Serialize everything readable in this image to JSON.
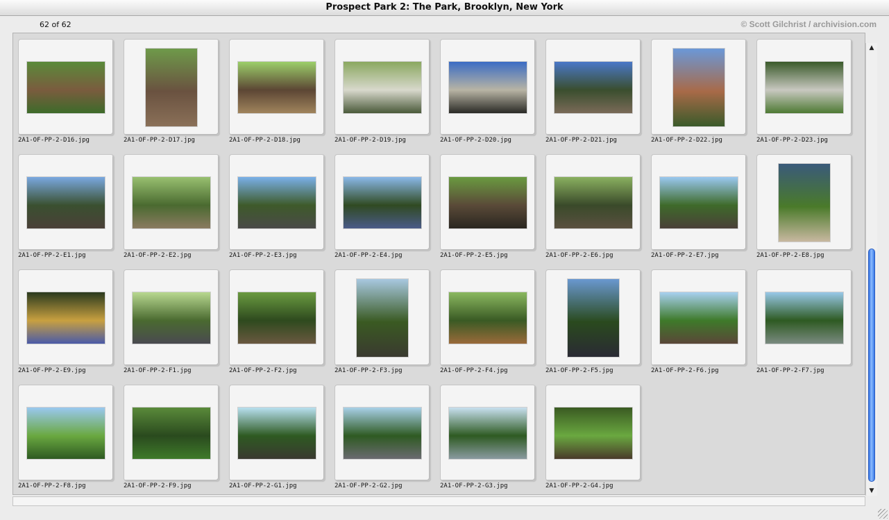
{
  "window": {
    "title": "Prospect Park 2: The Park, Brooklyn, New York"
  },
  "status": {
    "count": "62 of 62",
    "credit": "© Scott Gilchrist / archivision.com"
  },
  "icons": {
    "scroll_up": "scroll-up-arrow-icon",
    "scroll_down": "scroll-down-arrow-icon",
    "resize": "resize-grip-icon"
  },
  "thumbnails": [
    {
      "file": "2A1-OF-PP-2-D16.jpg",
      "orientation": "landscape",
      "colors": [
        "#5a8a3a",
        "#7a5c3e",
        "#3d6b2a"
      ]
    },
    {
      "file": "2A1-OF-PP-2-D17.jpg",
      "orientation": "portrait",
      "colors": [
        "#6e9a4a",
        "#6a5240",
        "#8a7058"
      ]
    },
    {
      "file": "2A1-OF-PP-2-D18.jpg",
      "orientation": "landscape",
      "colors": [
        "#9ccf6a",
        "#5c4634",
        "#a0845c"
      ]
    },
    {
      "file": "2A1-OF-PP-2-D19.jpg",
      "orientation": "landscape",
      "colors": [
        "#8aa860",
        "#d8d8cc",
        "#4a5a3a"
      ]
    },
    {
      "file": "2A1-OF-PP-2-D20.jpg",
      "orientation": "landscape",
      "colors": [
        "#3b6cc4",
        "#b8b4a4",
        "#2a2a26"
      ]
    },
    {
      "file": "2A1-OF-PP-2-D21.jpg",
      "orientation": "landscape",
      "colors": [
        "#4a78c8",
        "#3a4e2e",
        "#7a6a58"
      ]
    },
    {
      "file": "2A1-OF-PP-2-D22.jpg",
      "orientation": "portrait",
      "colors": [
        "#6a98d8",
        "#a86a48",
        "#3a5a2a"
      ]
    },
    {
      "file": "2A1-OF-PP-2-D23.jpg",
      "orientation": "landscape",
      "colors": [
        "#3a5a2a",
        "#c8c8c0",
        "#4e7a34"
      ]
    },
    {
      "file": "2A1-OF-PP-2-E1.jpg",
      "orientation": "landscape",
      "colors": [
        "#7aa8e0",
        "#3a5030",
        "#4a4038"
      ]
    },
    {
      "file": "2A1-OF-PP-2-E2.jpg",
      "orientation": "landscape",
      "colors": [
        "#98c070",
        "#4a6a30",
        "#8a7a60"
      ]
    },
    {
      "file": "2A1-OF-PP-2-E3.jpg",
      "orientation": "landscape",
      "colors": [
        "#7ab0e8",
        "#3e5a2a",
        "#4a4a48"
      ]
    },
    {
      "file": "2A1-OF-PP-2-E4.jpg",
      "orientation": "landscape",
      "colors": [
        "#8ab8e8",
        "#304a22",
        "#4a5a88"
      ]
    },
    {
      "file": "2A1-OF-PP-2-E5.jpg",
      "orientation": "landscape",
      "colors": [
        "#6a9a40",
        "#5a4a38",
        "#2a2620"
      ]
    },
    {
      "file": "2A1-OF-PP-2-E6.jpg",
      "orientation": "landscape",
      "colors": [
        "#8ab060",
        "#3a4a2a",
        "#5a5040"
      ]
    },
    {
      "file": "2A1-OF-PP-2-E7.jpg",
      "orientation": "landscape",
      "colors": [
        "#9ac8f0",
        "#3e6a2a",
        "#4a4038"
      ]
    },
    {
      "file": "2A1-OF-PP-2-E8.jpg",
      "orientation": "portrait",
      "colors": [
        "#3a5a7a",
        "#4a7a2a",
        "#c8b8a0"
      ]
    },
    {
      "file": "2A1-OF-PP-2-E9.jpg",
      "orientation": "landscape",
      "colors": [
        "#2a3a1e",
        "#c8a040",
        "#4a5aa8"
      ]
    },
    {
      "file": "2A1-OF-PP-2-F1.jpg",
      "orientation": "landscape",
      "colors": [
        "#b8d890",
        "#4a6a30",
        "#4a4a50"
      ]
    },
    {
      "file": "2A1-OF-PP-2-F2.jpg",
      "orientation": "landscape",
      "colors": [
        "#6a9a40",
        "#2e4a1e",
        "#6a5840"
      ]
    },
    {
      "file": "2A1-OF-PP-2-F3.jpg",
      "orientation": "portrait",
      "colors": [
        "#a8c8e0",
        "#3a5a22",
        "#3a3a30"
      ]
    },
    {
      "file": "2A1-OF-PP-2-F4.jpg",
      "orientation": "landscape",
      "colors": [
        "#8ab860",
        "#3a5a24",
        "#9a6a3a"
      ]
    },
    {
      "file": "2A1-OF-PP-2-F5.jpg",
      "orientation": "portrait",
      "colors": [
        "#6a98d0",
        "#2a4a1e",
        "#2a2a34"
      ]
    },
    {
      "file": "2A1-OF-PP-2-F6.jpg",
      "orientation": "landscape",
      "colors": [
        "#a8d0f0",
        "#3e7a2a",
        "#5a4638"
      ]
    },
    {
      "file": "2A1-OF-PP-2-F7.jpg",
      "orientation": "landscape",
      "colors": [
        "#98c8e8",
        "#2e5a22",
        "#7a8a80"
      ]
    },
    {
      "file": "2A1-OF-PP-2-F8.jpg",
      "orientation": "landscape",
      "colors": [
        "#9ac8f0",
        "#6aa840",
        "#2e5a22"
      ]
    },
    {
      "file": "2A1-OF-PP-2-F9.jpg",
      "orientation": "landscape",
      "colors": [
        "#5a8a3a",
        "#2a4a1e",
        "#3e7a2a"
      ]
    },
    {
      "file": "2A1-OF-PP-2-G1.jpg",
      "orientation": "landscape",
      "colors": [
        "#b8e0f0",
        "#2e5a22",
        "#3a3a30"
      ]
    },
    {
      "file": "2A1-OF-PP-2-G2.jpg",
      "orientation": "landscape",
      "colors": [
        "#a8d0e8",
        "#2e5a22",
        "#6a6a70"
      ]
    },
    {
      "file": "2A1-OF-PP-2-G3.jpg",
      "orientation": "landscape",
      "colors": [
        "#c8e0f0",
        "#2e5a22",
        "#8a9aa0"
      ]
    },
    {
      "file": "2A1-OF-PP-2-G4.jpg",
      "orientation": "landscape",
      "colors": [
        "#3a5a22",
        "#6aa840",
        "#4a3a2a"
      ]
    }
  ]
}
